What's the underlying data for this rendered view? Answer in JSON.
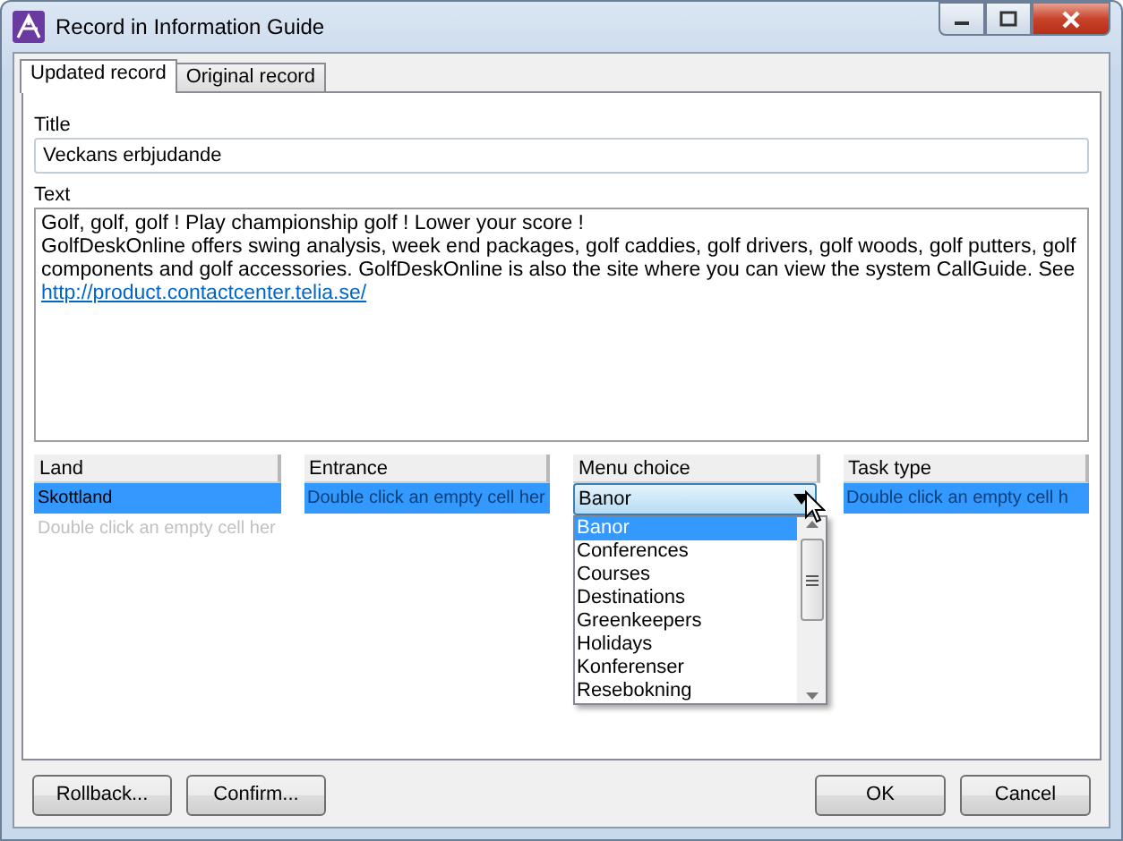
{
  "window": {
    "title": "Record in Information Guide"
  },
  "tabs": [
    {
      "label": "Updated record",
      "selected": true
    },
    {
      "label": "Original record",
      "selected": false
    }
  ],
  "title_field": {
    "label": "Title",
    "value": "Veckans erbjudande"
  },
  "text_field": {
    "label": "Text",
    "body": [
      {
        "kind": "text",
        "text": "Golf, golf, golf !  Play championship golf !  Lower your score !"
      },
      {
        "kind": "text",
        "text": "GolfDeskOnline offers swing analysis, week end packages, golf caddies, golf drivers, golf woods, golf putters, golf components and golf accessories. GolfDeskOnline is also the site where you can view the system CallGuide. See"
      },
      {
        "kind": "link",
        "text": "http://product.contactcenter.telia.se/"
      }
    ]
  },
  "columns": [
    {
      "header": "Land",
      "kind": "text",
      "rows": [
        {
          "value": "Skottland",
          "selected": true
        },
        {
          "placeholder": "Double click an empty cell her",
          "selected": false
        }
      ]
    },
    {
      "header": "Entrance",
      "kind": "text",
      "rows": [
        {
          "placeholder": "Double click an empty cell her",
          "selected": true
        }
      ]
    },
    {
      "header": "Menu choice",
      "kind": "combo",
      "value": "Banor",
      "options": [
        {
          "label": "Banor",
          "selected": true
        },
        {
          "label": "Conferences",
          "selected": false
        },
        {
          "label": "Courses",
          "selected": false
        },
        {
          "label": "Destinations",
          "selected": false
        },
        {
          "label": "Greenkeepers",
          "selected": false
        },
        {
          "label": "Holidays",
          "selected": false
        },
        {
          "label": "Konferenser",
          "selected": false
        },
        {
          "label": "Resebokning",
          "selected": false
        }
      ]
    },
    {
      "header": "Task type",
      "kind": "text",
      "rows": [
        {
          "placeholder": "Double click an empty cell h",
          "selected": true
        }
      ]
    }
  ],
  "buttons_left": [
    "Rollback...",
    "Confirm..."
  ],
  "buttons_right": [
    "OK",
    "Cancel"
  ]
}
